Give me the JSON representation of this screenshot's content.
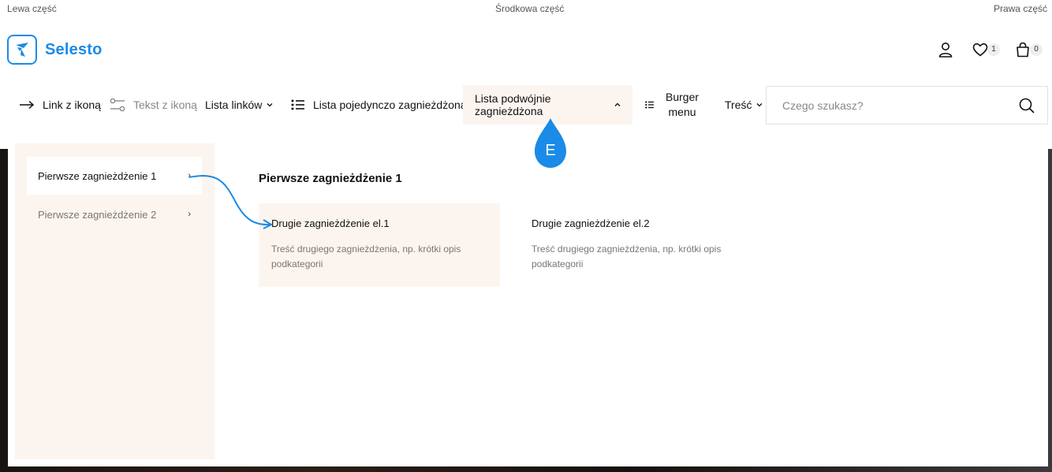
{
  "topbar": {
    "left": "Lewa część",
    "center": "Środkowa część",
    "right": "Prawa część"
  },
  "header": {
    "logo_text": "Selesto",
    "wishlist_count": "1",
    "cart_count": "0"
  },
  "nav": {
    "link_with_icon": "Link z ikoną",
    "text_with_icon": "Tekst z ikoną",
    "link_list": "Lista linków",
    "single_nested_list": "Lista pojedynczo zagnieżdżona",
    "double_nested_list": "Lista podwójnie zagnieżdżona",
    "burger_line1": "Burger",
    "burger_line2": "menu",
    "content": "Treść"
  },
  "search": {
    "placeholder": "Czego szukasz?"
  },
  "mega_menu": {
    "sidebar": [
      {
        "label": "Pierwsze zagnieżdżenie 1",
        "arrow": "›"
      },
      {
        "label": "Pierwsze zagnieżdżenie 2",
        "arrow": "›"
      }
    ],
    "section_title": "Pierwsze zagnieżdżenie 1",
    "cards": [
      {
        "title": "Drugie zagnieżdżenie el.1",
        "description": "Treść drugiego zagnieżdżenia, np. krótki opis podkategorii"
      },
      {
        "title": "Drugie zagnieżdżenie el.2",
        "description": "Treść drugiego zagnieżdżenia, np. krótki opis podkategorii"
      }
    ]
  },
  "marker": {
    "letter": "E",
    "color": "#1a8be6"
  },
  "colors": {
    "brand": "#1a8be6",
    "highlight_bg": "#fcf5ef"
  }
}
